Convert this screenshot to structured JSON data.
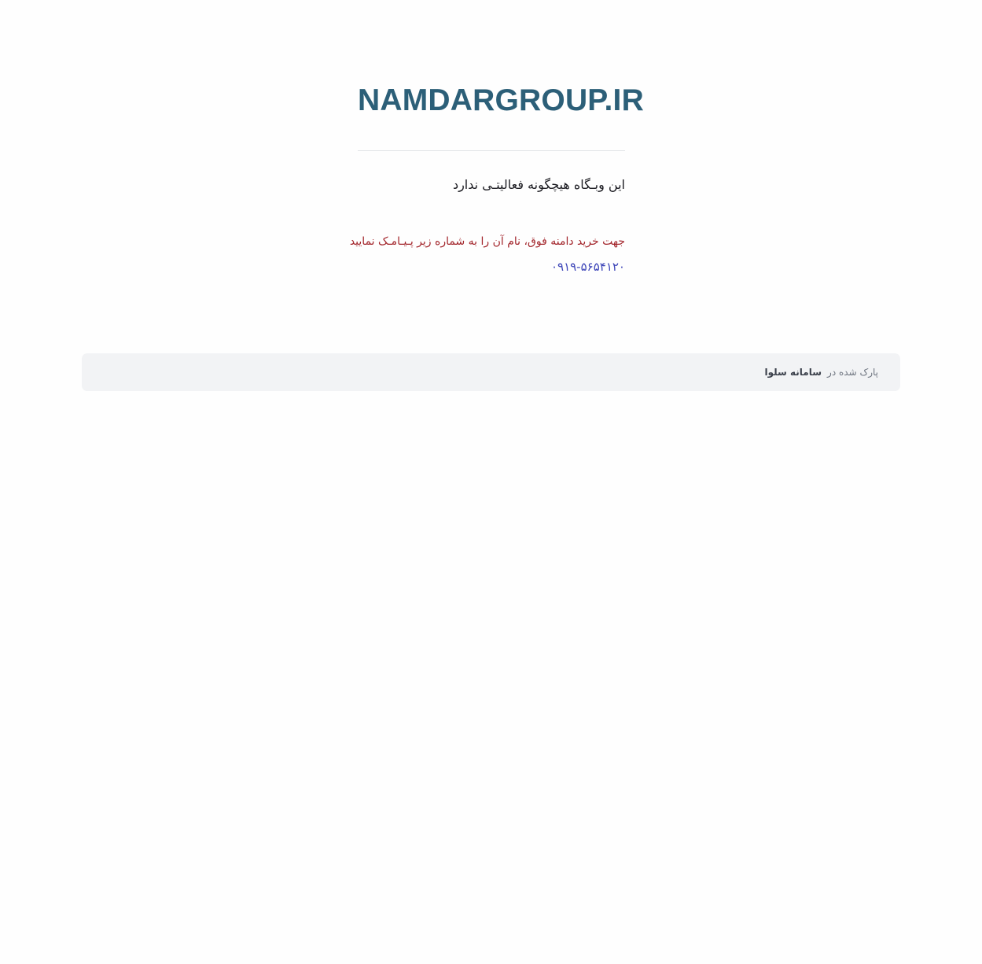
{
  "header": {
    "domain": "NAMDARGROUP.IR"
  },
  "main": {
    "inactive_message": "این وبـگاه هیچگونه فعالیتـی ندارد",
    "purchase_message": "جهت خرید دامنه فوق، نام آن را به شماره زیر پـیـامـک نمایید",
    "phone_number": "۰۹۱۹-۵۶۵۴۱۲۰"
  },
  "footer": {
    "parked_label": "پارک شده در",
    "system_name": "سامانه سلوا"
  },
  "colors": {
    "title": "#2c5f78",
    "purchase_text": "#a3262c",
    "phone_link": "#3d45b8",
    "footer_bg": "#f2f3f5"
  }
}
